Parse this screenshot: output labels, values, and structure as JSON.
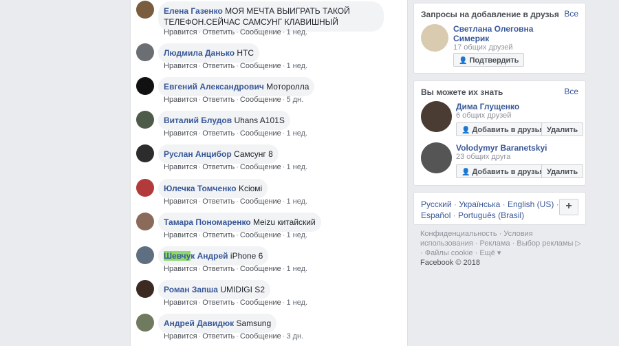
{
  "comments": [
    {
      "name": "Елена Газенко",
      "text": "МОЯ МЕЧТА ВЫИГРАТЬ ТАКОЙ",
      "text2": "ТЕЛЕФОН.СЕЙЧАС САМСУНГ КЛАВИШНЫЙ",
      "time": "1 нед."
    },
    {
      "name": "Людмила Данько",
      "text": "HTC",
      "time": "1 нед."
    },
    {
      "name": "Евгений Александрович",
      "text": "Моторолла",
      "time": "5 дн."
    },
    {
      "name": "Виталий Блудов",
      "text": "Uhans A101S",
      "time": "1 нед."
    },
    {
      "name": "Руслан Анцибор",
      "text": "Самсунг 8",
      "time": "1 нед."
    },
    {
      "name": "Юлечка Томченко",
      "text": "Kсiомі",
      "time": "1 нед."
    },
    {
      "name": "Тамара Пономаренко",
      "text": "Meizu китайский",
      "time": "1 нед."
    },
    {
      "name_hl": "Шевчу",
      "name_rest": "к Андрей",
      "text": "iPhone 6",
      "time": "1 нед."
    },
    {
      "name": "Роман Запша",
      "text": "UMIDIGI S2",
      "time": "1 нед."
    },
    {
      "name": "Андрей Давидюк",
      "text": "Samsung",
      "time": "3 дн."
    }
  ],
  "actions": {
    "like": "Нравится",
    "reply": "Ответить",
    "message": "Сообщение",
    "dot": "·"
  },
  "requests": {
    "title": "Запросы на добавление в друзья",
    "all": "Все",
    "person": {
      "name1": "Светлана Олеговна",
      "name2": "Симерик",
      "mutual": "17 общих друзей",
      "confirm": "Подтвердить"
    }
  },
  "pymk": {
    "title": "Вы можете их знать",
    "all": "Все",
    "people": [
      {
        "name": "Дима Глущенко",
        "mutual": "6 общих друзей",
        "add": "Добавить в друзья",
        "remove": "Удалить"
      },
      {
        "name": "Volodymyr Baranetskyi",
        "mutual": "23 общих друга",
        "add": "Добавить в друзья",
        "remove": "Удалить"
      }
    ]
  },
  "languages": {
    "items": [
      "Русский",
      "Українська",
      "English (US)",
      "Español",
      "Português (Brasil)"
    ],
    "plus": "+"
  },
  "footer": {
    "privacy": "Конфиденциальность",
    "terms": "Условия",
    "terms2": "использования",
    "ads": "Реклама",
    "adchoices": "Выбор рекламы",
    "cookies": "Файлы cookie",
    "more": "Ещё",
    "copyright": "Facebook © 2018"
  },
  "icons": {
    "person_plus": "person-plus-icon",
    "adchoices": "adchoices-icon",
    "caret": "caret-down-icon"
  }
}
